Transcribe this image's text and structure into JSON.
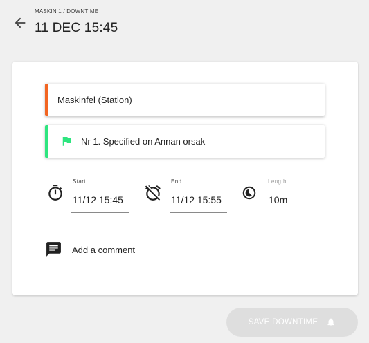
{
  "header": {
    "breadcrumb": "MASKIN 1 / DOWNTIME",
    "title": "11 DEC 15:45"
  },
  "reasons": [
    {
      "label": "Maskinfel (Station)",
      "accent_color": "#f26522"
    },
    {
      "label": "Nr 1. Specified on Annan orsak",
      "accent_color": "#2ee57f",
      "icon": "flag-icon"
    }
  ],
  "times": {
    "start": {
      "label": "Start",
      "value": "11/12 15:45",
      "icon": "stopwatch-icon"
    },
    "end": {
      "label": "End",
      "value": "11/12 15:55",
      "icon": "alarm-off-icon"
    },
    "length": {
      "label": "Length",
      "value": "10m",
      "icon": "timelapse-icon"
    }
  },
  "comment": {
    "placeholder": "Add a comment",
    "value": "",
    "icon": "comment-icon"
  },
  "actions": {
    "save_label": "SAVE DOWNTIME",
    "save_icon": "bell-icon",
    "enabled": false
  }
}
